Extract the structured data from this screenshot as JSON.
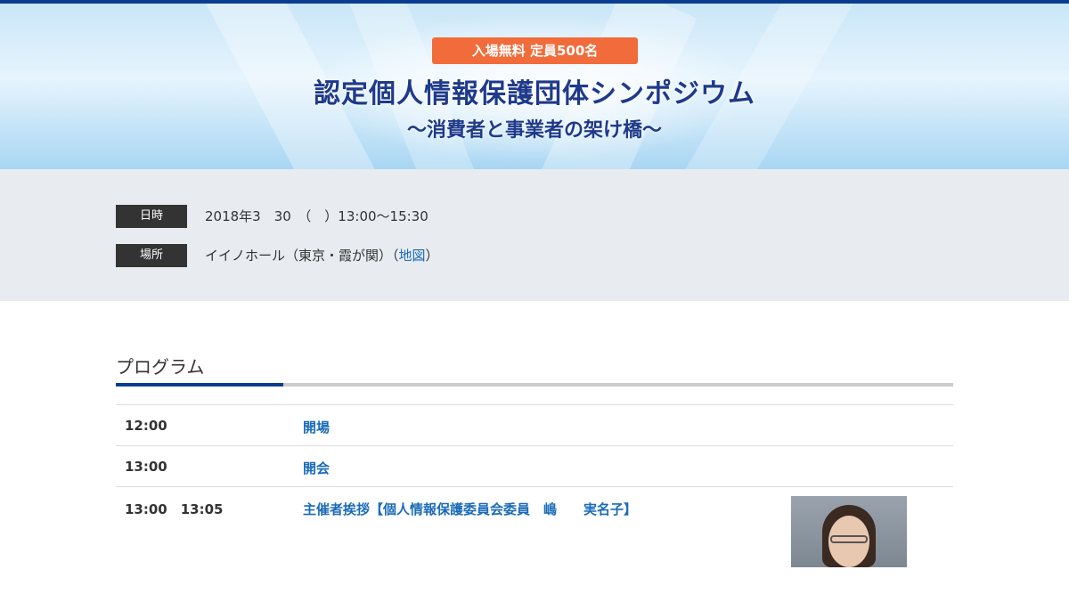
{
  "hero": {
    "badge": "入場無料 定員500名",
    "title": "認定個人情報保護団体シンポジウム",
    "subtitle": "〜消費者と事業者の架け橋〜"
  },
  "info": {
    "date_label": "日時",
    "date_value": "2018年3　30　（　）13:00〜15:30",
    "place_label": "場所",
    "place_value": "イイノホール（東京・霞が関）（",
    "map_link": "地図",
    "place_close": "）"
  },
  "program": {
    "title": "プログラム",
    "rows": [
      {
        "time": "12:00",
        "item": "開場"
      },
      {
        "time": "13:00",
        "item": "開会"
      },
      {
        "time": "13:00　13:05",
        "item": "主催者挨拶【個人情報保護委員会委員　嶋　　実名子】"
      }
    ]
  },
  "colors": {
    "accent": "#0a3d8f",
    "badge": "#f26b3a",
    "link": "#1a6bb8",
    "title": "#1e3a8a"
  }
}
